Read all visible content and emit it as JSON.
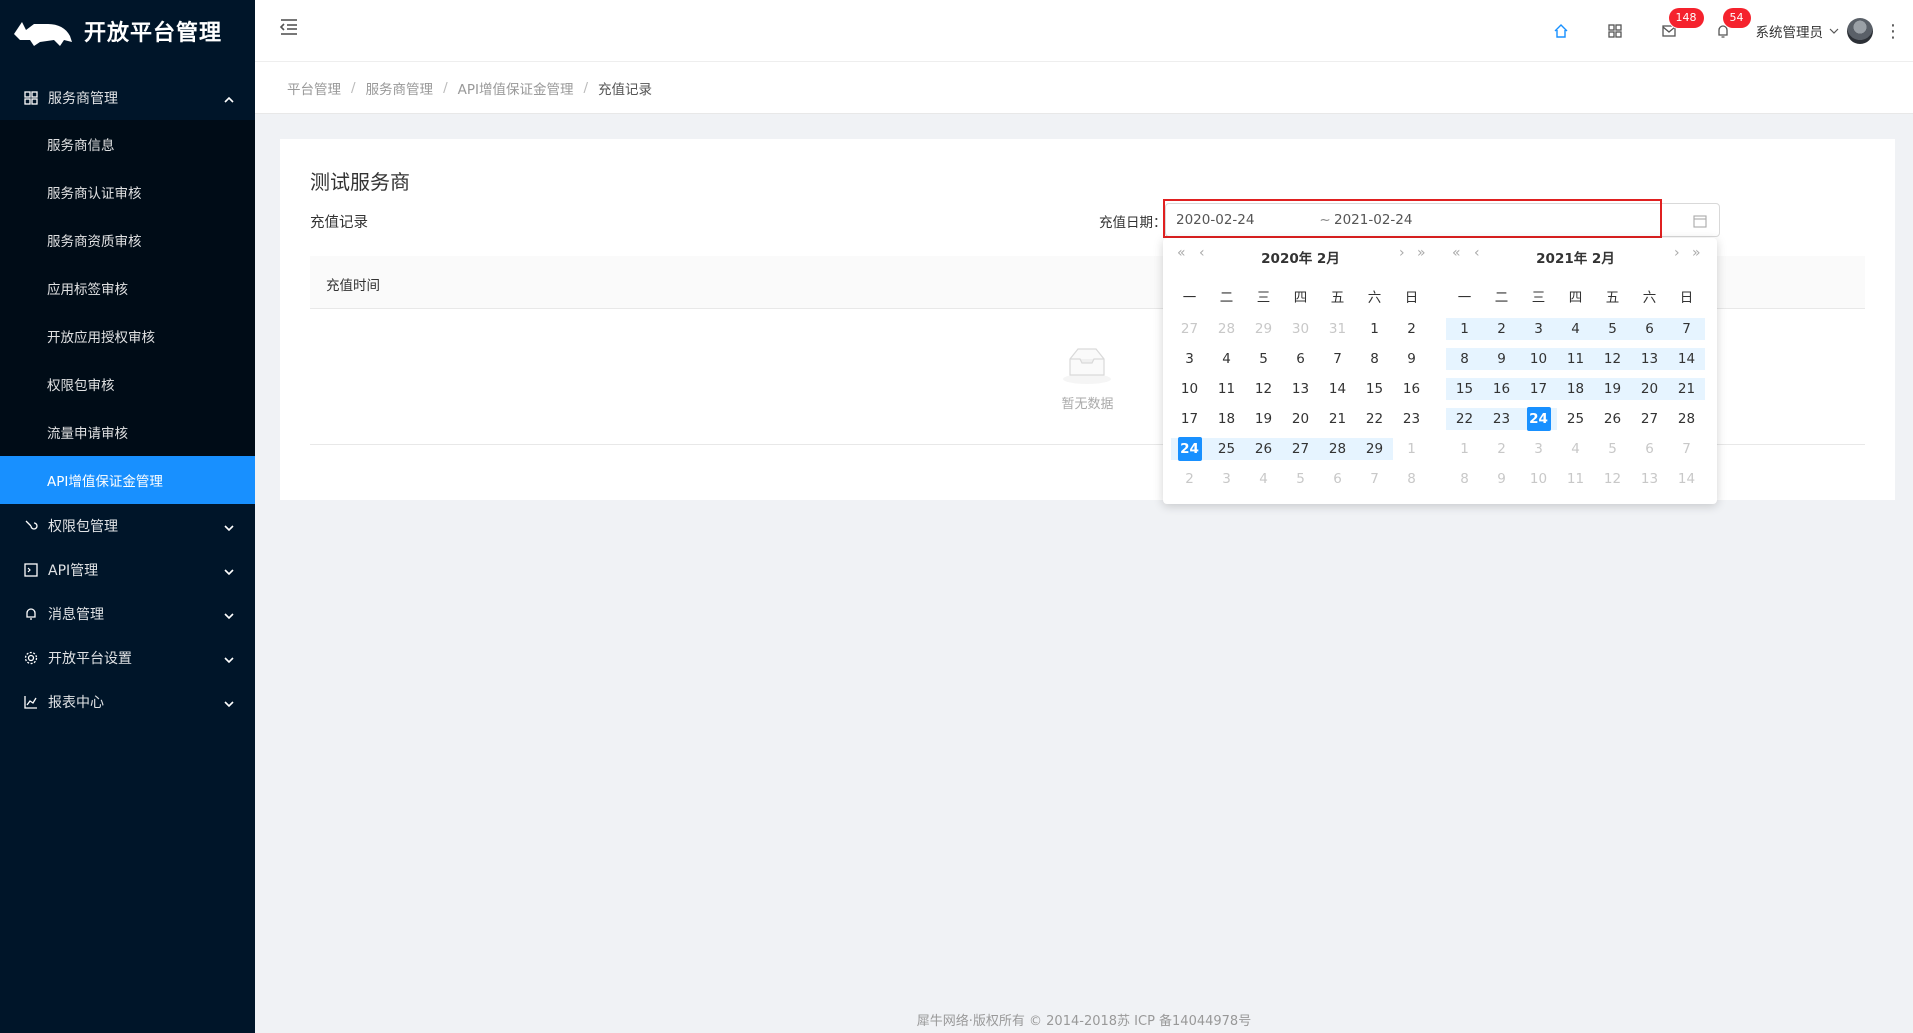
{
  "app": {
    "title": "开放平台管理"
  },
  "sidebar": {
    "groups": [
      {
        "label": "服务商管理",
        "icon": "apps-icon",
        "expanded": true,
        "items": [
          "服务商信息",
          "服务商认证审核",
          "服务商资质审核",
          "应用标签审核",
          "开放应用授权审核",
          "权限包审核",
          "流量申请审核",
          "API增值保证金管理"
        ]
      },
      {
        "label": "权限包管理",
        "icon": "link-icon"
      },
      {
        "label": "API管理",
        "icon": "code-icon"
      },
      {
        "label": "消息管理",
        "icon": "bell-icon"
      },
      {
        "label": "开放平台设置",
        "icon": "gear-icon"
      },
      {
        "label": "报表中心",
        "icon": "chart-icon"
      }
    ],
    "active_item": "API增值保证金管理"
  },
  "header": {
    "mail_badge": "148",
    "notice_badge": "54",
    "user_name": "系统管理员"
  },
  "breadcrumb": [
    "平台管理",
    "服务商管理",
    "API增值保证金管理",
    "充值记录"
  ],
  "main": {
    "title": "测试服务商",
    "subtitle": "充值记录",
    "date_label": "充值日期：",
    "date_start": "2020-02-24",
    "date_sep": "~",
    "date_end": "2021-02-24",
    "table_header": "充值时间",
    "empty_text": "暂无数据"
  },
  "calendar": {
    "weekdays": [
      "一",
      "二",
      "三",
      "四",
      "五",
      "六",
      "日"
    ],
    "left": {
      "title": "2020年 2月",
      "rows": [
        [
          [
            "27",
            "out"
          ],
          [
            "28",
            "out"
          ],
          [
            "29",
            "out"
          ],
          [
            "30",
            "out"
          ],
          [
            "31",
            "out"
          ],
          [
            "1",
            ""
          ],
          [
            "2",
            ""
          ]
        ],
        [
          [
            "3",
            ""
          ],
          [
            "4",
            ""
          ],
          [
            "5",
            ""
          ],
          [
            "6",
            ""
          ],
          [
            "7",
            ""
          ],
          [
            "8",
            ""
          ],
          [
            "9",
            ""
          ]
        ],
        [
          [
            "10",
            ""
          ],
          [
            "11",
            ""
          ],
          [
            "12",
            ""
          ],
          [
            "13",
            ""
          ],
          [
            "14",
            ""
          ],
          [
            "15",
            ""
          ],
          [
            "16",
            ""
          ]
        ],
        [
          [
            "17",
            ""
          ],
          [
            "18",
            ""
          ],
          [
            "19",
            ""
          ],
          [
            "20",
            ""
          ],
          [
            "21",
            ""
          ],
          [
            "22",
            ""
          ],
          [
            "23",
            ""
          ]
        ],
        [
          [
            "24",
            "sel"
          ],
          [
            "25",
            "range"
          ],
          [
            "26",
            "range"
          ],
          [
            "27",
            "range"
          ],
          [
            "28",
            "range"
          ],
          [
            "29",
            "range"
          ],
          [
            "1",
            "out"
          ]
        ],
        [
          [
            "2",
            "out"
          ],
          [
            "3",
            "out"
          ],
          [
            "4",
            "out"
          ],
          [
            "5",
            "out"
          ],
          [
            "6",
            "out"
          ],
          [
            "7",
            "out"
          ],
          [
            "8",
            "out"
          ]
        ]
      ]
    },
    "right": {
      "title": "2021年 2月",
      "rows": [
        [
          [
            "1",
            "range"
          ],
          [
            "2",
            "range"
          ],
          [
            "3",
            "range"
          ],
          [
            "4",
            "range"
          ],
          [
            "5",
            "range"
          ],
          [
            "6",
            "range"
          ],
          [
            "7",
            "range"
          ]
        ],
        [
          [
            "8",
            "range"
          ],
          [
            "9",
            "range"
          ],
          [
            "10",
            "range"
          ],
          [
            "11",
            "range"
          ],
          [
            "12",
            "range"
          ],
          [
            "13",
            "range"
          ],
          [
            "14",
            "range"
          ]
        ],
        [
          [
            "15",
            "range"
          ],
          [
            "16",
            "range"
          ],
          [
            "17",
            "range"
          ],
          [
            "18",
            "range"
          ],
          [
            "19",
            "range"
          ],
          [
            "20",
            "range"
          ],
          [
            "21",
            "range"
          ]
        ],
        [
          [
            "22",
            "range"
          ],
          [
            "23",
            "range"
          ],
          [
            "24",
            "sel"
          ],
          [
            "25",
            ""
          ],
          [
            "26",
            ""
          ],
          [
            "27",
            ""
          ],
          [
            "28",
            ""
          ]
        ],
        [
          [
            "1",
            "out"
          ],
          [
            "2",
            "out"
          ],
          [
            "3",
            "out"
          ],
          [
            "4",
            "out"
          ],
          [
            "5",
            "out"
          ],
          [
            "6",
            "out"
          ],
          [
            "7",
            "out"
          ]
        ],
        [
          [
            "8",
            "out"
          ],
          [
            "9",
            "out"
          ],
          [
            "10",
            "out"
          ],
          [
            "11",
            "out"
          ],
          [
            "12",
            "out"
          ],
          [
            "13",
            "out"
          ],
          [
            "14",
            "out"
          ]
        ]
      ]
    }
  },
  "footer": {
    "text": "犀牛网络·版权所有 © 2014-2018苏 ICP 备14044978号"
  },
  "colors": {
    "sidebar_bg": "#001529",
    "accent": "#1890ff",
    "badge": "#f5222d",
    "highlight_frame": "#e02020"
  }
}
